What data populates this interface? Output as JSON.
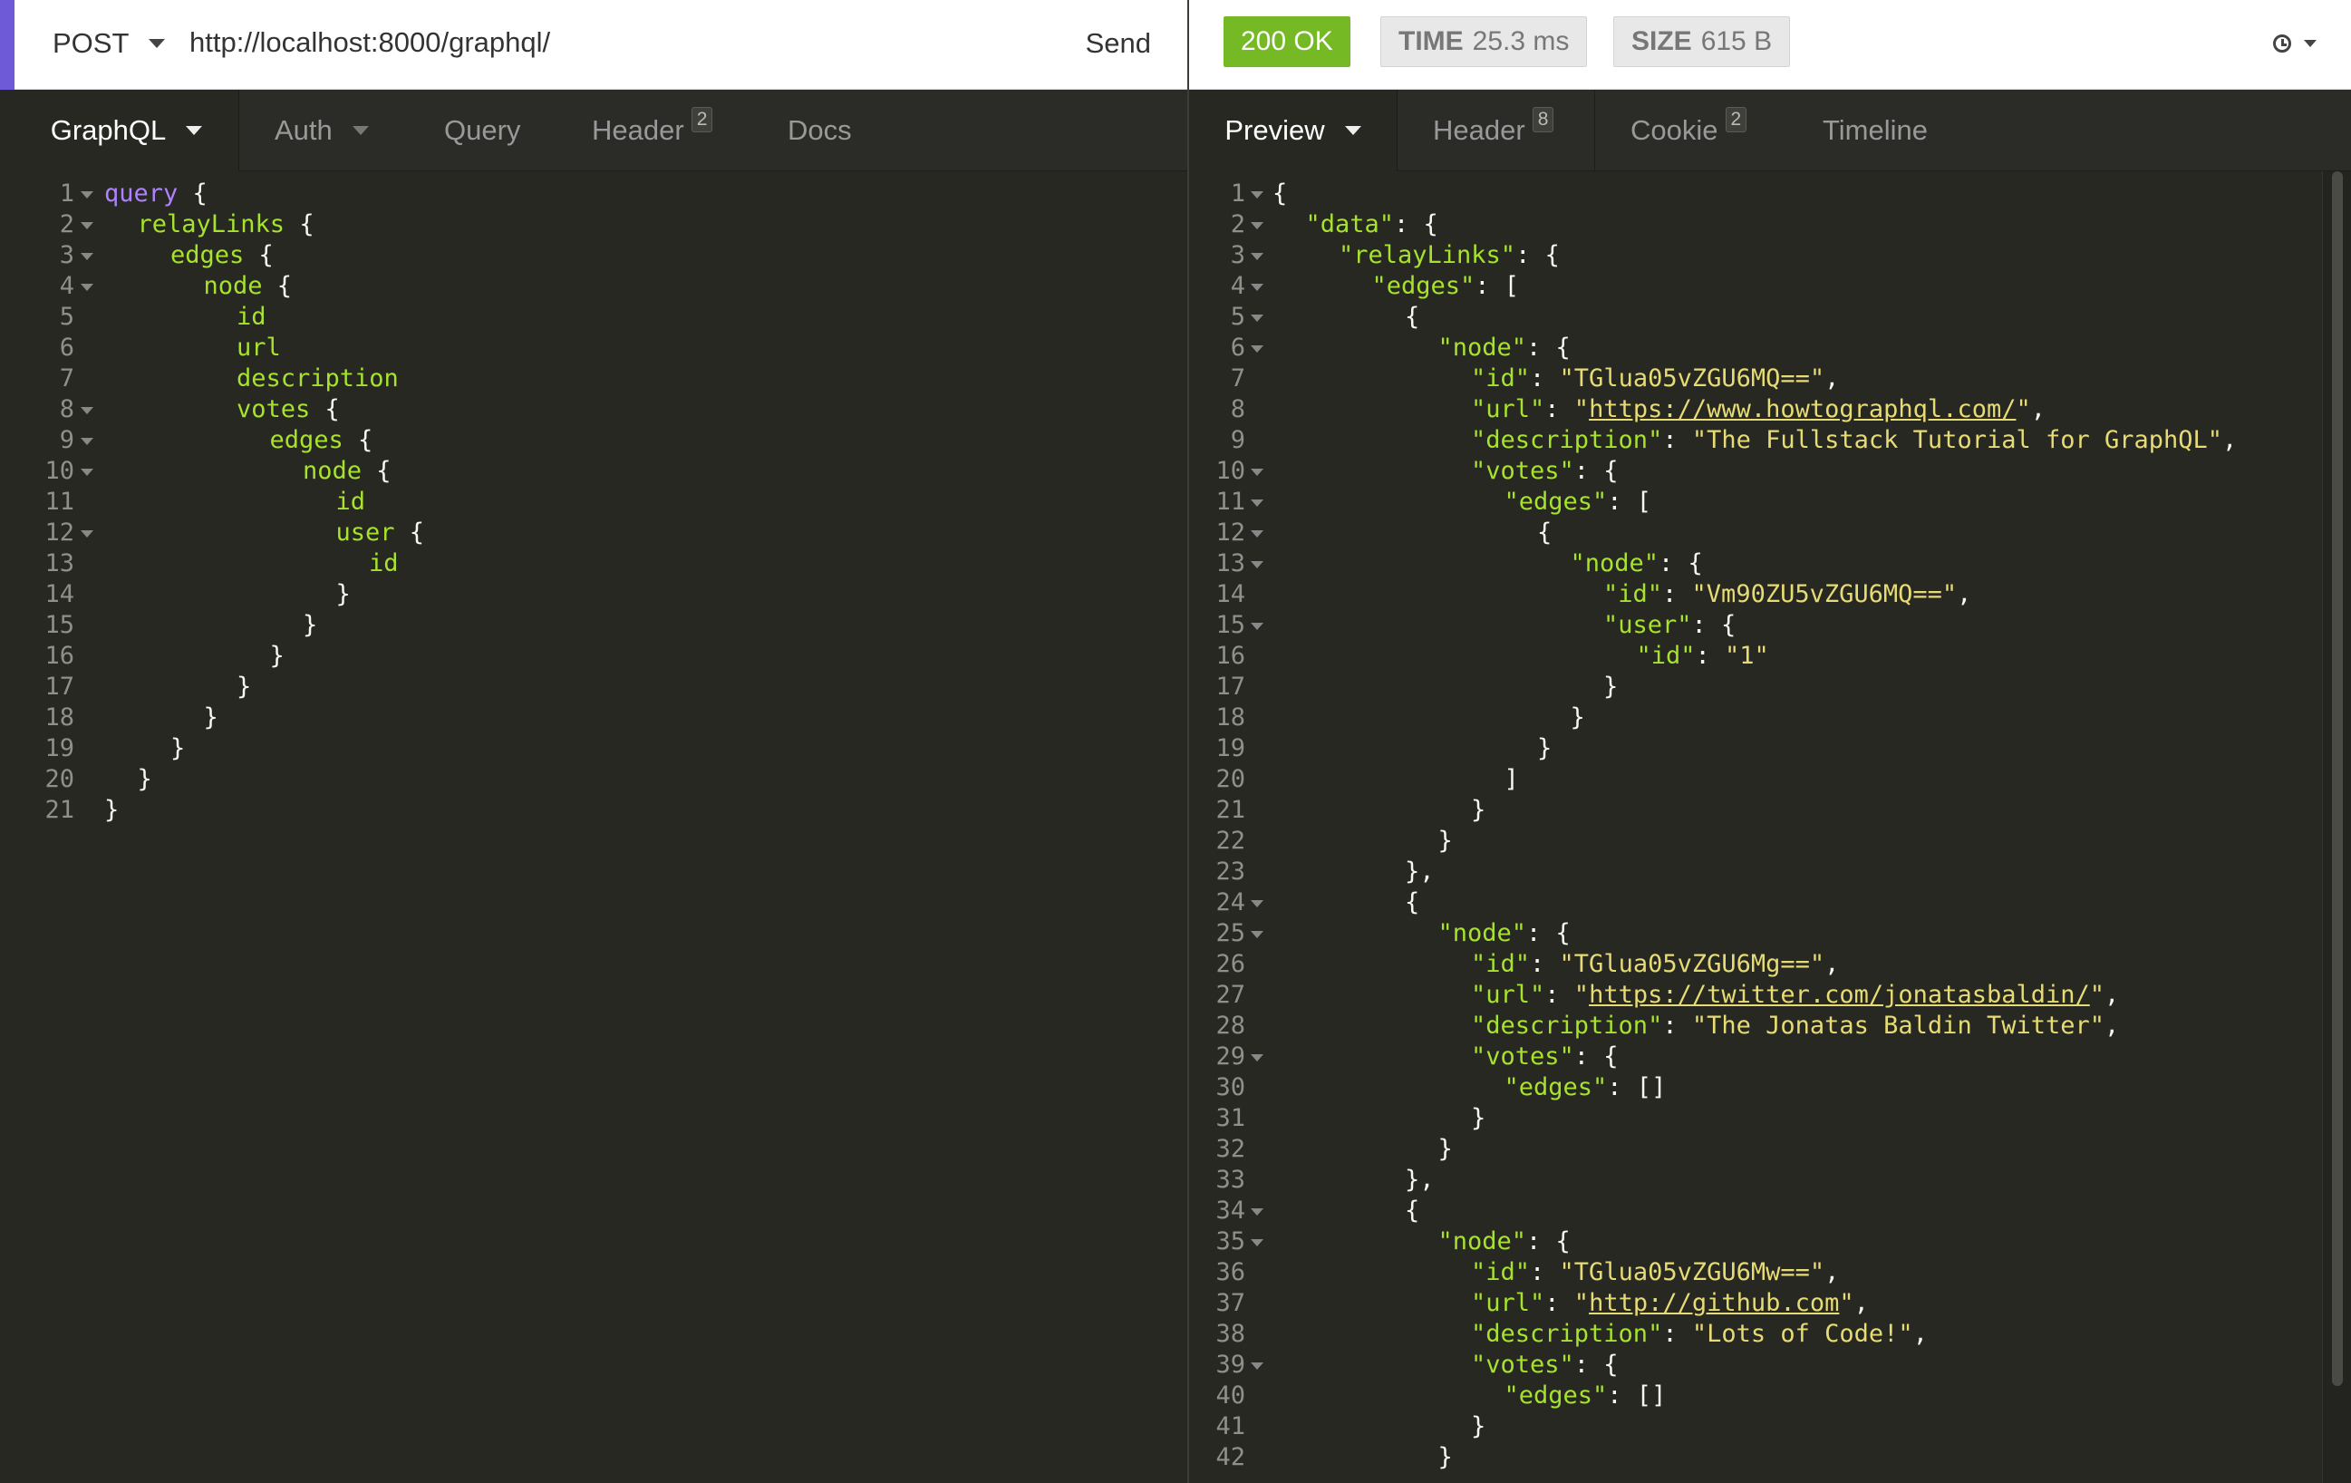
{
  "request": {
    "method": "POST",
    "url": "http://localhost:8000/graphql/",
    "send_label": "Send"
  },
  "response": {
    "status": "200 OK",
    "time_label": "TIME",
    "time_value": "25.3 ms",
    "size_label": "SIZE",
    "size_value": "615 B"
  },
  "request_tabs": [
    {
      "label": "GraphQL"
    },
    {
      "label": "Auth"
    },
    {
      "label": "Query"
    },
    {
      "label": "Header",
      "badge": "2"
    },
    {
      "label": "Docs"
    }
  ],
  "response_tabs": [
    {
      "label": "Preview"
    },
    {
      "label": "Header",
      "badge": "8"
    },
    {
      "label": "Cookie",
      "badge": "2"
    },
    {
      "label": "Timeline"
    }
  ],
  "query_lines": [
    {
      "indent": 0,
      "fold": true,
      "tokens": [
        [
          "k",
          "query"
        ],
        [
          "p",
          " {"
        ]
      ]
    },
    {
      "indent": 1,
      "fold": true,
      "tokens": [
        [
          "f",
          "relayLinks"
        ],
        [
          "p",
          " {"
        ]
      ]
    },
    {
      "indent": 2,
      "fold": true,
      "tokens": [
        [
          "f",
          "edges"
        ],
        [
          "p",
          " {"
        ]
      ]
    },
    {
      "indent": 3,
      "fold": true,
      "tokens": [
        [
          "f",
          "node"
        ],
        [
          "p",
          " {"
        ]
      ]
    },
    {
      "indent": 4,
      "tokens": [
        [
          "f",
          "id"
        ]
      ]
    },
    {
      "indent": 4,
      "tokens": [
        [
          "f",
          "url"
        ]
      ]
    },
    {
      "indent": 4,
      "tokens": [
        [
          "f",
          "description"
        ]
      ]
    },
    {
      "indent": 4,
      "fold": true,
      "tokens": [
        [
          "f",
          "votes"
        ],
        [
          "p",
          " {"
        ]
      ]
    },
    {
      "indent": 5,
      "fold": true,
      "tokens": [
        [
          "f",
          "edges"
        ],
        [
          "p",
          " {"
        ]
      ]
    },
    {
      "indent": 6,
      "fold": true,
      "tokens": [
        [
          "f",
          "node"
        ],
        [
          "p",
          " {"
        ]
      ]
    },
    {
      "indent": 7,
      "tokens": [
        [
          "f",
          "id"
        ]
      ]
    },
    {
      "indent": 7,
      "fold": true,
      "tokens": [
        [
          "f",
          "user"
        ],
        [
          "p",
          " {"
        ]
      ]
    },
    {
      "indent": 8,
      "tokens": [
        [
          "f",
          "id"
        ]
      ]
    },
    {
      "indent": 7,
      "tokens": [
        [
          "p",
          "}"
        ]
      ]
    },
    {
      "indent": 6,
      "tokens": [
        [
          "p",
          "}"
        ]
      ]
    },
    {
      "indent": 5,
      "tokens": [
        [
          "p",
          "}"
        ]
      ]
    },
    {
      "indent": 4,
      "tokens": [
        [
          "p",
          "}"
        ]
      ]
    },
    {
      "indent": 3,
      "tokens": [
        [
          "p",
          "}"
        ]
      ]
    },
    {
      "indent": 2,
      "tokens": [
        [
          "p",
          "}"
        ]
      ]
    },
    {
      "indent": 1,
      "tokens": [
        [
          "p",
          "}"
        ]
      ]
    },
    {
      "indent": 0,
      "tokens": [
        [
          "p",
          "}"
        ]
      ]
    }
  ],
  "response_lines": [
    {
      "indent": 0,
      "fold": true,
      "tokens": [
        [
          "p",
          "{"
        ]
      ]
    },
    {
      "indent": 1,
      "fold": true,
      "tokens": [
        [
          "f",
          "\"data\""
        ],
        [
          "p",
          ": {"
        ]
      ]
    },
    {
      "indent": 2,
      "fold": true,
      "tokens": [
        [
          "f",
          "\"relayLinks\""
        ],
        [
          "p",
          ": {"
        ]
      ]
    },
    {
      "indent": 3,
      "fold": true,
      "tokens": [
        [
          "f",
          "\"edges\""
        ],
        [
          "p",
          ": ["
        ]
      ]
    },
    {
      "indent": 4,
      "fold": true,
      "tokens": [
        [
          "p",
          "{"
        ]
      ]
    },
    {
      "indent": 5,
      "fold": true,
      "tokens": [
        [
          "f",
          "\"node\""
        ],
        [
          "p",
          ": {"
        ]
      ]
    },
    {
      "indent": 6,
      "tokens": [
        [
          "f",
          "\"id\""
        ],
        [
          "p",
          ": "
        ],
        [
          "s",
          "\"TGlua05vZGU6MQ==\""
        ],
        [
          "p",
          ","
        ]
      ]
    },
    {
      "indent": 6,
      "tokens": [
        [
          "f",
          "\"url\""
        ],
        [
          "p",
          ": "
        ],
        [
          "s",
          "\""
        ],
        [
          "u",
          "https://www.howtographql.com/"
        ],
        [
          "s",
          "\""
        ],
        [
          "p",
          ","
        ]
      ]
    },
    {
      "indent": 6,
      "tokens": [
        [
          "f",
          "\"description\""
        ],
        [
          "p",
          ": "
        ],
        [
          "s",
          "\"The Fullstack Tutorial for GraphQL\""
        ],
        [
          "p",
          ","
        ]
      ]
    },
    {
      "indent": 6,
      "fold": true,
      "tokens": [
        [
          "f",
          "\"votes\""
        ],
        [
          "p",
          ": {"
        ]
      ]
    },
    {
      "indent": 7,
      "fold": true,
      "tokens": [
        [
          "f",
          "\"edges\""
        ],
        [
          "p",
          ": ["
        ]
      ]
    },
    {
      "indent": 8,
      "fold": true,
      "tokens": [
        [
          "p",
          "{"
        ]
      ]
    },
    {
      "indent": 9,
      "fold": true,
      "tokens": [
        [
          "f",
          "\"node\""
        ],
        [
          "p",
          ": {"
        ]
      ]
    },
    {
      "indent": 10,
      "tokens": [
        [
          "f",
          "\"id\""
        ],
        [
          "p",
          ": "
        ],
        [
          "s",
          "\"Vm90ZU5vZGU6MQ==\""
        ],
        [
          "p",
          ","
        ]
      ]
    },
    {
      "indent": 10,
      "fold": true,
      "tokens": [
        [
          "f",
          "\"user\""
        ],
        [
          "p",
          ": {"
        ]
      ]
    },
    {
      "indent": 11,
      "tokens": [
        [
          "f",
          "\"id\""
        ],
        [
          "p",
          ": "
        ],
        [
          "s",
          "\"1\""
        ]
      ]
    },
    {
      "indent": 10,
      "tokens": [
        [
          "p",
          "}"
        ]
      ]
    },
    {
      "indent": 9,
      "tokens": [
        [
          "p",
          "}"
        ]
      ]
    },
    {
      "indent": 8,
      "tokens": [
        [
          "p",
          "}"
        ]
      ]
    },
    {
      "indent": 7,
      "tokens": [
        [
          "p",
          "]"
        ]
      ]
    },
    {
      "indent": 6,
      "tokens": [
        [
          "p",
          "}"
        ]
      ]
    },
    {
      "indent": 5,
      "tokens": [
        [
          "p",
          "}"
        ]
      ]
    },
    {
      "indent": 4,
      "tokens": [
        [
          "p",
          "},"
        ]
      ]
    },
    {
      "indent": 4,
      "fold": true,
      "tokens": [
        [
          "p",
          "{"
        ]
      ]
    },
    {
      "indent": 5,
      "fold": true,
      "tokens": [
        [
          "f",
          "\"node\""
        ],
        [
          "p",
          ": {"
        ]
      ]
    },
    {
      "indent": 6,
      "tokens": [
        [
          "f",
          "\"id\""
        ],
        [
          "p",
          ": "
        ],
        [
          "s",
          "\"TGlua05vZGU6Mg==\""
        ],
        [
          "p",
          ","
        ]
      ]
    },
    {
      "indent": 6,
      "tokens": [
        [
          "f",
          "\"url\""
        ],
        [
          "p",
          ": "
        ],
        [
          "s",
          "\""
        ],
        [
          "u",
          "https://twitter.com/jonatasbaldin/"
        ],
        [
          "s",
          "\""
        ],
        [
          "p",
          ","
        ]
      ]
    },
    {
      "indent": 6,
      "tokens": [
        [
          "f",
          "\"description\""
        ],
        [
          "p",
          ": "
        ],
        [
          "s",
          "\"The Jonatas Baldin Twitter\""
        ],
        [
          "p",
          ","
        ]
      ]
    },
    {
      "indent": 6,
      "fold": true,
      "tokens": [
        [
          "f",
          "\"votes\""
        ],
        [
          "p",
          ": {"
        ]
      ]
    },
    {
      "indent": 7,
      "tokens": [
        [
          "f",
          "\"edges\""
        ],
        [
          "p",
          ": []"
        ]
      ]
    },
    {
      "indent": 6,
      "tokens": [
        [
          "p",
          "}"
        ]
      ]
    },
    {
      "indent": 5,
      "tokens": [
        [
          "p",
          "}"
        ]
      ]
    },
    {
      "indent": 4,
      "tokens": [
        [
          "p",
          "},"
        ]
      ]
    },
    {
      "indent": 4,
      "fold": true,
      "tokens": [
        [
          "p",
          "{"
        ]
      ]
    },
    {
      "indent": 5,
      "fold": true,
      "tokens": [
        [
          "f",
          "\"node\""
        ],
        [
          "p",
          ": {"
        ]
      ]
    },
    {
      "indent": 6,
      "tokens": [
        [
          "f",
          "\"id\""
        ],
        [
          "p",
          ": "
        ],
        [
          "s",
          "\"TGlua05vZGU6Mw==\""
        ],
        [
          "p",
          ","
        ]
      ]
    },
    {
      "indent": 6,
      "tokens": [
        [
          "f",
          "\"url\""
        ],
        [
          "p",
          ": "
        ],
        [
          "s",
          "\""
        ],
        [
          "u",
          "http://github.com"
        ],
        [
          "s",
          "\""
        ],
        [
          "p",
          ","
        ]
      ]
    },
    {
      "indent": 6,
      "tokens": [
        [
          "f",
          "\"description\""
        ],
        [
          "p",
          ": "
        ],
        [
          "s",
          "\"Lots of Code!\""
        ],
        [
          "p",
          ","
        ]
      ]
    },
    {
      "indent": 6,
      "fold": true,
      "tokens": [
        [
          "f",
          "\"votes\""
        ],
        [
          "p",
          ": {"
        ]
      ]
    },
    {
      "indent": 7,
      "tokens": [
        [
          "f",
          "\"edges\""
        ],
        [
          "p",
          ": []"
        ]
      ]
    },
    {
      "indent": 6,
      "tokens": [
        [
          "p",
          "}"
        ]
      ]
    },
    {
      "indent": 5,
      "tokens": [
        [
          "p",
          "}"
        ]
      ]
    }
  ],
  "icons": {
    "method_dropdown": "chevron-down-icon",
    "history": "clock-icon",
    "fold": "fold-triangle-icon"
  }
}
